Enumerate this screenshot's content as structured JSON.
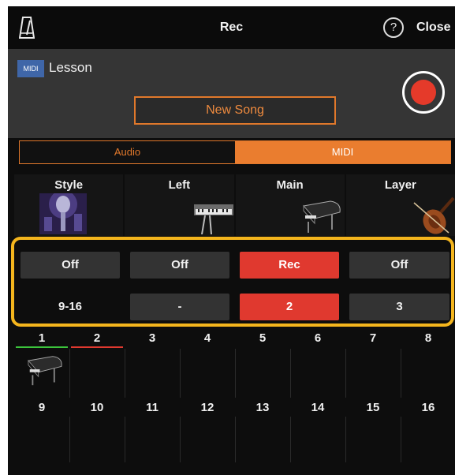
{
  "header": {
    "title": "Rec",
    "close_label": "Close",
    "help_glyph": "?"
  },
  "lesson": {
    "badge": "MIDI",
    "name": "Lesson",
    "new_song_label": "New Song"
  },
  "mode": {
    "audio_label": "Audio",
    "midi_label": "MIDI",
    "selected": "MIDI"
  },
  "parts": [
    {
      "label": "Style",
      "icon": "microphone-stage-icon"
    },
    {
      "label": "Left",
      "icon": "electric-piano-icon"
    },
    {
      "label": "Main",
      "icon": "grand-piano-icon"
    },
    {
      "label": "Layer",
      "icon": "violin-icon"
    }
  ],
  "part_states": [
    "Off",
    "Off",
    "Rec",
    "Off"
  ],
  "channel_row": [
    "9-16",
    "-",
    "2",
    "3"
  ],
  "tracks_row1": [
    "1",
    "2",
    "3",
    "4",
    "5",
    "6",
    "7",
    "8"
  ],
  "tracks_row2": [
    "9",
    "10",
    "11",
    "12",
    "13",
    "14",
    "15",
    "16"
  ],
  "colors": {
    "accent": "#ea7d2f",
    "rec": "#e0392f",
    "highlight": "#f4b51d",
    "track1": "#3cc43c",
    "track2": "#e0392f"
  }
}
